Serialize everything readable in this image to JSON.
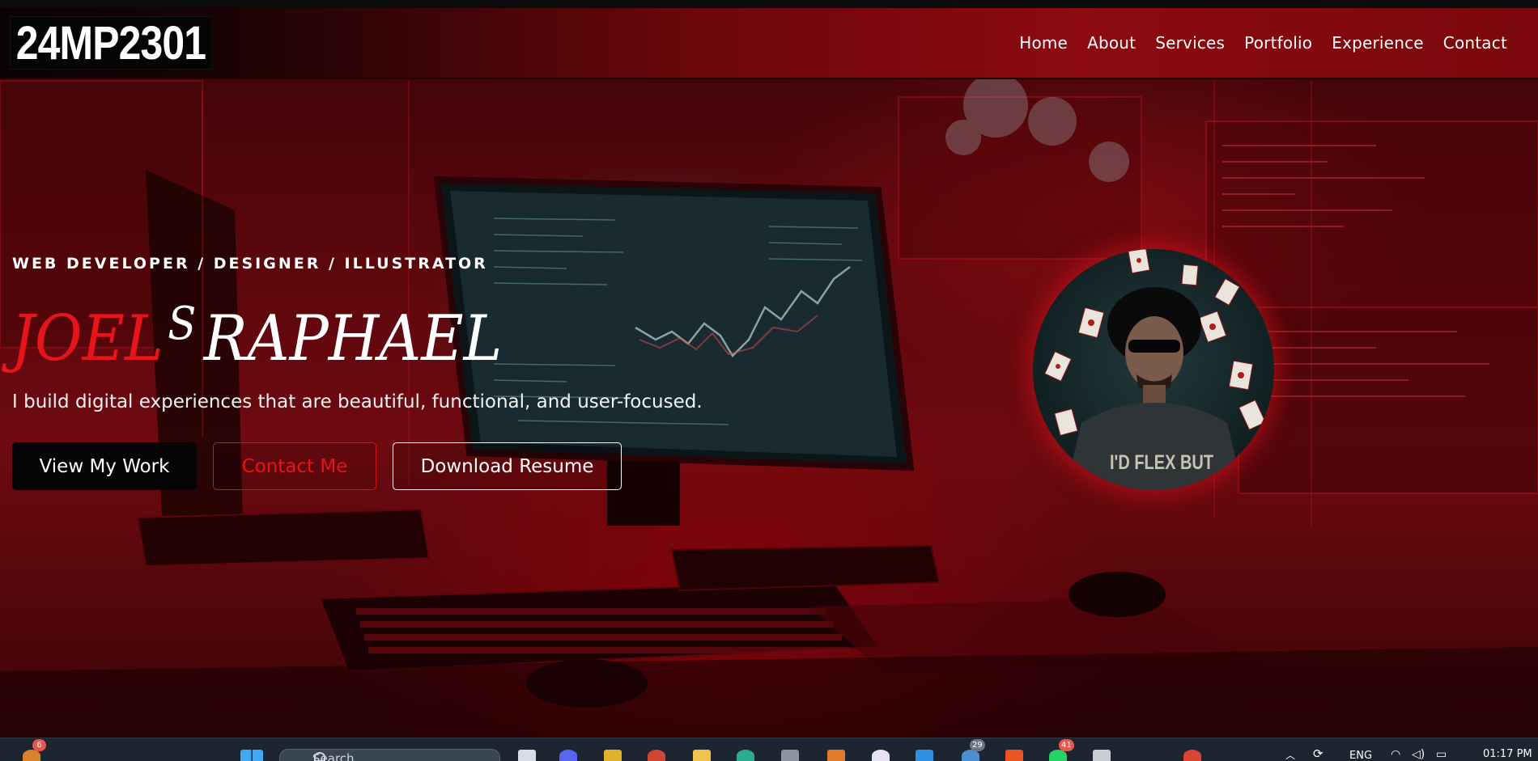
{
  "navbar": {
    "logo": "24MP2301",
    "links": [
      "Home",
      "About",
      "Services",
      "Portfolio",
      "Experience",
      "Contact"
    ]
  },
  "hero": {
    "kicker": "WEB DEVELOPER / DESIGNER / ILLUSTRATOR",
    "name_first": "JOEL",
    "name_middle": "S",
    "name_last": "RAPHAEL",
    "tagline": "I build digital experiences that are beautiful, functional, and user-focused.",
    "buttons": {
      "work": "View My Work",
      "contact": "Contact Me",
      "resume": "Download Resume"
    },
    "avatar_shirt_text": "I'D FLEX BUT"
  },
  "taskbar": {
    "widget_badge": "6",
    "search_placeholder": "Search",
    "app_badge_1": "29",
    "app_badge_2": "41",
    "language": "ENG",
    "time": "01:17 PM"
  },
  "colors": {
    "accent_red": "#e8141c",
    "navbar_red": "#8c0a10",
    "background_dark": "#3a0508",
    "taskbar": "#1d2630"
  }
}
